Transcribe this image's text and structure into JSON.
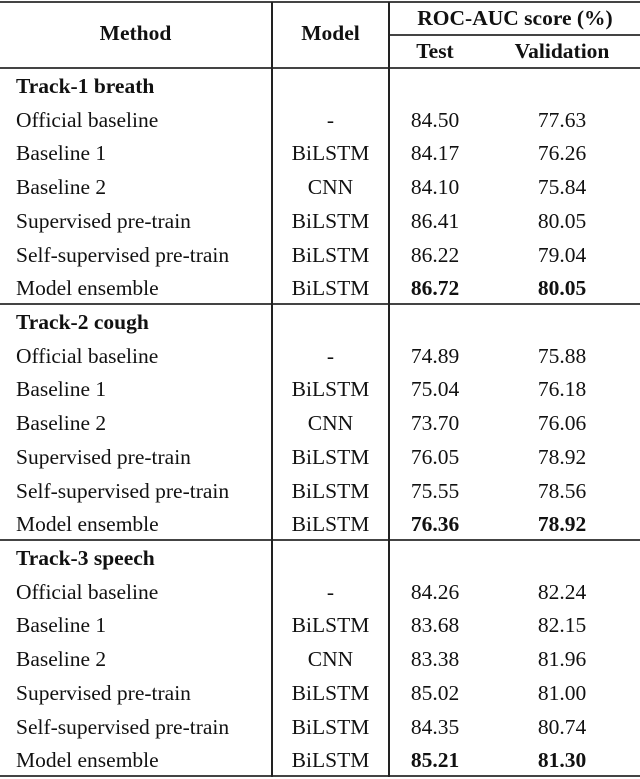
{
  "header": {
    "method": "Method",
    "model": "Model",
    "score_group": "ROC-AUC score (%)",
    "test": "Test",
    "validation": "Validation"
  },
  "sections": [
    {
      "title": "Track-1 breath",
      "rows": [
        {
          "method": "Official baseline",
          "model": "-",
          "test": "84.50",
          "validation": "77.63",
          "bold": false
        },
        {
          "method": "Baseline 1",
          "model": "BiLSTM",
          "test": "84.17",
          "validation": "76.26",
          "bold": false
        },
        {
          "method": "Baseline 2",
          "model": "CNN",
          "test": "84.10",
          "validation": "75.84",
          "bold": false
        },
        {
          "method": "Supervised pre-train",
          "model": "BiLSTM",
          "test": "86.41",
          "validation": "80.05",
          "bold": false
        },
        {
          "method": "Self-supervised pre-train",
          "model": "BiLSTM",
          "test": "86.22",
          "validation": "79.04",
          "bold": false
        },
        {
          "method": "Model ensemble",
          "model": "BiLSTM",
          "test": "86.72",
          "validation": "80.05",
          "bold": true
        }
      ]
    },
    {
      "title": "Track-2 cough",
      "rows": [
        {
          "method": "Official baseline",
          "model": "-",
          "test": "74.89",
          "validation": "75.88",
          "bold": false
        },
        {
          "method": "Baseline 1",
          "model": "BiLSTM",
          "test": "75.04",
          "validation": "76.18",
          "bold": false
        },
        {
          "method": "Baseline 2",
          "model": "CNN",
          "test": "73.70",
          "validation": "76.06",
          "bold": false
        },
        {
          "method": "Supervised pre-train",
          "model": "BiLSTM",
          "test": "76.05",
          "validation": "78.92",
          "bold": false
        },
        {
          "method": "Self-supervised pre-train",
          "model": "BiLSTM",
          "test": "75.55",
          "validation": "78.56",
          "bold": false
        },
        {
          "method": "Model ensemble",
          "model": "BiLSTM",
          "test": "76.36",
          "validation": "78.92",
          "bold": true
        }
      ]
    },
    {
      "title": "Track-3 speech",
      "rows": [
        {
          "method": "Official baseline",
          "model": "-",
          "test": "84.26",
          "validation": "82.24",
          "bold": false
        },
        {
          "method": "Baseline 1",
          "model": "BiLSTM",
          "test": "83.68",
          "validation": "82.15",
          "bold": false
        },
        {
          "method": "Baseline 2",
          "model": "CNN",
          "test": "83.38",
          "validation": "81.96",
          "bold": false
        },
        {
          "method": "Supervised pre-train",
          "model": "BiLSTM",
          "test": "85.02",
          "validation": "81.00",
          "bold": false
        },
        {
          "method": "Self-supervised pre-train",
          "model": "BiLSTM",
          "test": "84.35",
          "validation": "80.74",
          "bold": false
        },
        {
          "method": "Model ensemble",
          "model": "BiLSTM",
          "test": "85.21",
          "validation": "81.30",
          "bold": true
        }
      ]
    }
  ]
}
